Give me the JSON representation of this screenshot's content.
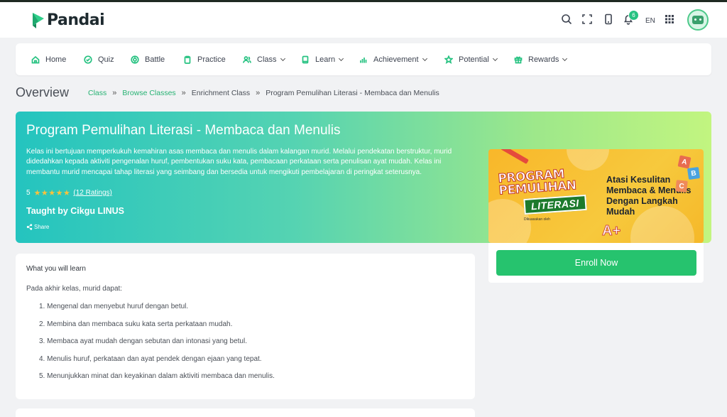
{
  "app": {
    "name": "Pandai"
  },
  "header": {
    "language": "EN",
    "notification_count": "6"
  },
  "nav": {
    "items": [
      {
        "label": "Home"
      },
      {
        "label": "Quiz"
      },
      {
        "label": "Battle"
      },
      {
        "label": "Practice"
      },
      {
        "label": "Class"
      },
      {
        "label": "Learn"
      },
      {
        "label": "Achievement"
      },
      {
        "label": "Potential"
      },
      {
        "label": "Rewards"
      }
    ]
  },
  "page": {
    "title": "Overview"
  },
  "breadcrumb": {
    "class": "Class",
    "browse": "Browse Classes",
    "enrichment": "Enrichment Class",
    "current": "Program Pemulihan Literasi - Membaca dan Menulis"
  },
  "course": {
    "title": "Program Pemulihan Literasi - Membaca dan Menulis",
    "description": "Kelas ini bertujuan memperkukuh kemahiran asas membaca dan menulis dalam kalangan murid. Melalui pendekatan berstruktur, murid didedahkan kepada aktiviti pengenalan huruf, pembentukan suku kata, pembacaan perkataan serta penulisan ayat mudah. Kelas ini membantu murid mencapai tahap literasi yang seimbang dan bersedia untuk mengikuti pembelajaran di peringkat seterusnya.",
    "rating": "5",
    "rating_count": "(12 Ratings)",
    "teacher": "Taught by Cikgu LINUS",
    "share": "Share"
  },
  "banner": {
    "line1": "PROGRAM",
    "line2": "PEMULIHAN",
    "literasi": "LITERASI",
    "powered": "Dikuasakan oleh",
    "headline": "Atasi Kesulitan Membaca & Menulis Dengan Langkah Mudah",
    "grade": "A+"
  },
  "learn": {
    "title": "What you will learn",
    "intro": "Pada akhir kelas, murid dapat:",
    "items": [
      "1. Mengenal dan menyebut huruf dengan betul.",
      "2. Membina dan membaca suku kata serta perkataan mudah.",
      "3. Membaca ayat mudah dengan sebutan dan intonasi yang betul.",
      "4. Menulis huruf, perkataan dan ayat pendek dengan ejaan yang tepat.",
      "5. Menunjukkan minat dan keyakinan dalam aktiviti membaca dan menulis."
    ]
  },
  "enroll": {
    "label": "Enroll Now"
  },
  "colors": {
    "accent": "#26c281",
    "enroll": "#26c36e",
    "star": "#f9c23c"
  }
}
